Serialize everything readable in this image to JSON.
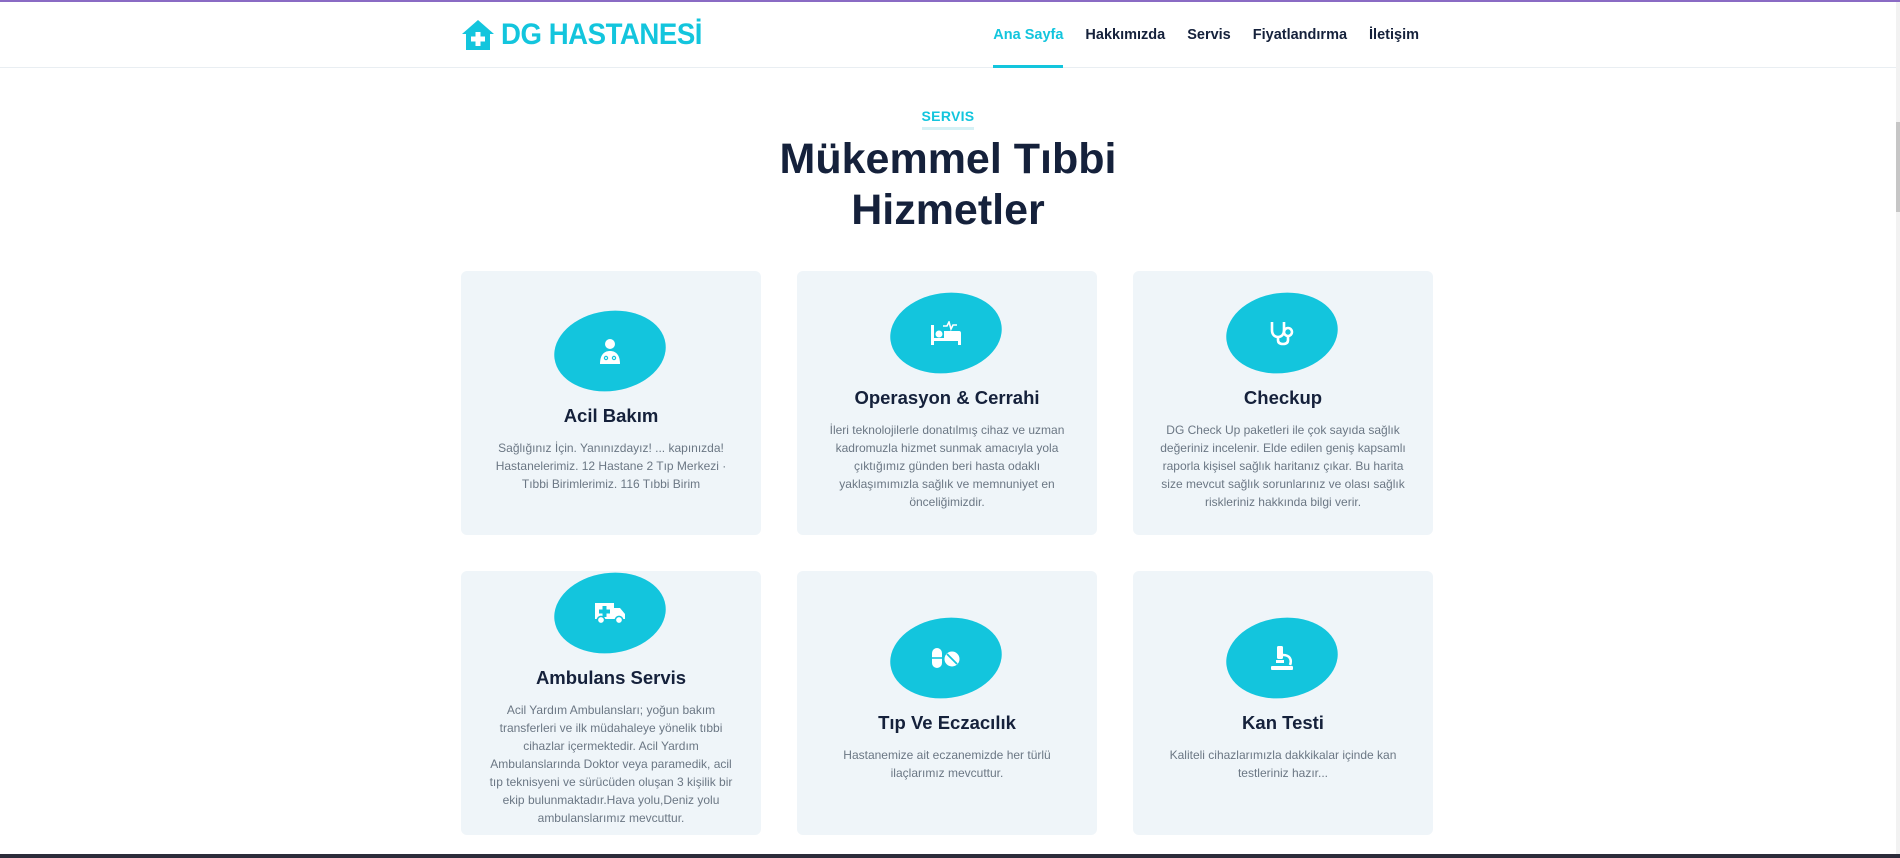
{
  "brand": {
    "name": "DG HASTANESİ",
    "icon": "hospital-house-icon"
  },
  "nav": {
    "items": [
      {
        "label": "Ana Sayfa",
        "active": true
      },
      {
        "label": "Hakkımızda",
        "active": false
      },
      {
        "label": "Servis",
        "active": false
      },
      {
        "label": "Fiyatlandırma",
        "active": false
      },
      {
        "label": "İletişim",
        "active": false
      }
    ]
  },
  "section": {
    "label": "SERVIS",
    "title_line1": "Mükemmel Tıbbi",
    "title_line2": "Hizmetler"
  },
  "services": [
    {
      "icon": "doctor-icon",
      "title": "Acil Bakım",
      "text": "Sağlığınız İçin. Yanınızdayız! ... kapınızda! Hastanelerimiz. 12 Hastane 2 Tıp Merkezi · Tıbbi Birimlerimiz. 116 Tıbbi Birim"
    },
    {
      "icon": "hospital-bed-icon",
      "title": "Operasyon & Cerrahi",
      "text": "İleri teknolojilerle donatılmış cihaz ve uzman kadromuzla hizmet sunmak amacıyla yola çıktığımız günden beri hasta odaklı yaklaşımımızla sağlık ve memnuniyet en önceliğimizdir."
    },
    {
      "icon": "stethoscope-icon",
      "title": "Checkup",
      "text": "DG Check Up paketleri ile çok sayıda sağlık değeriniz incelenir. Elde edilen geniş kapsamlı raporla kişisel sağlık haritanız çıkar. Bu harita size mevcut sağlık sorunlarınız ve olası sağlık riskleriniz hakkında bilgi verir."
    },
    {
      "icon": "ambulance-icon",
      "title": "Ambulans Servis",
      "text": "Acil Yardım Ambulansları; yoğun bakım transferleri ve ilk müdahaleye yönelik tıbbi cihazlar içermektedir. Acil Yardım Ambulanslarında Doktor veya paramedik, acil tıp teknisyeni ve sürücüden oluşan 3 kişilik bir ekip bulunmaktadır.Hava yolu,Deniz yolu ambulanslarımız mevcuttur."
    },
    {
      "icon": "pills-icon",
      "title": "Tıp Ve Eczacılık",
      "text": "Hastanemize ait eczanemizde her türlü ilaçlarımız mevcuttur."
    },
    {
      "icon": "microscope-icon",
      "title": "Kan Testi",
      "text": "Kaliteli cihazlarımızla dakkikalar içinde kan testleriniz hazır..."
    }
  ],
  "colors": {
    "accent": "#13c5dd",
    "dark": "#15213b",
    "card_bg": "#eff5f9",
    "muted": "#6b7784"
  }
}
